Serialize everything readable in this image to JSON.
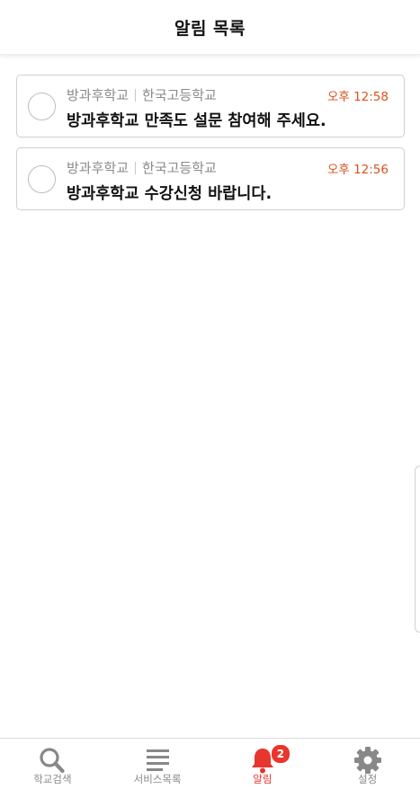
{
  "header": {
    "title": "알림 목록"
  },
  "notifications": [
    {
      "category": "방과후학교",
      "school": "한국고등학교",
      "time": "오후 12:58",
      "message": "방과후학교 만족도 설문 참여해 주세요."
    },
    {
      "category": "방과후학교",
      "school": "한국고등학교",
      "time": "오후 12:56",
      "message": "방과후학교 수강신청 바랍니다."
    }
  ],
  "tabbar": {
    "tabs": [
      {
        "label": "학교검색",
        "icon": "search-icon"
      },
      {
        "label": "서비스목록",
        "icon": "list-icon"
      },
      {
        "label": "알림",
        "icon": "bell-icon",
        "badge": "2",
        "active": true
      },
      {
        "label": "설정",
        "icon": "gear-icon"
      }
    ]
  },
  "colors": {
    "accent": "#e8352e",
    "time": "#d9531e",
    "inactive": "#888888"
  }
}
